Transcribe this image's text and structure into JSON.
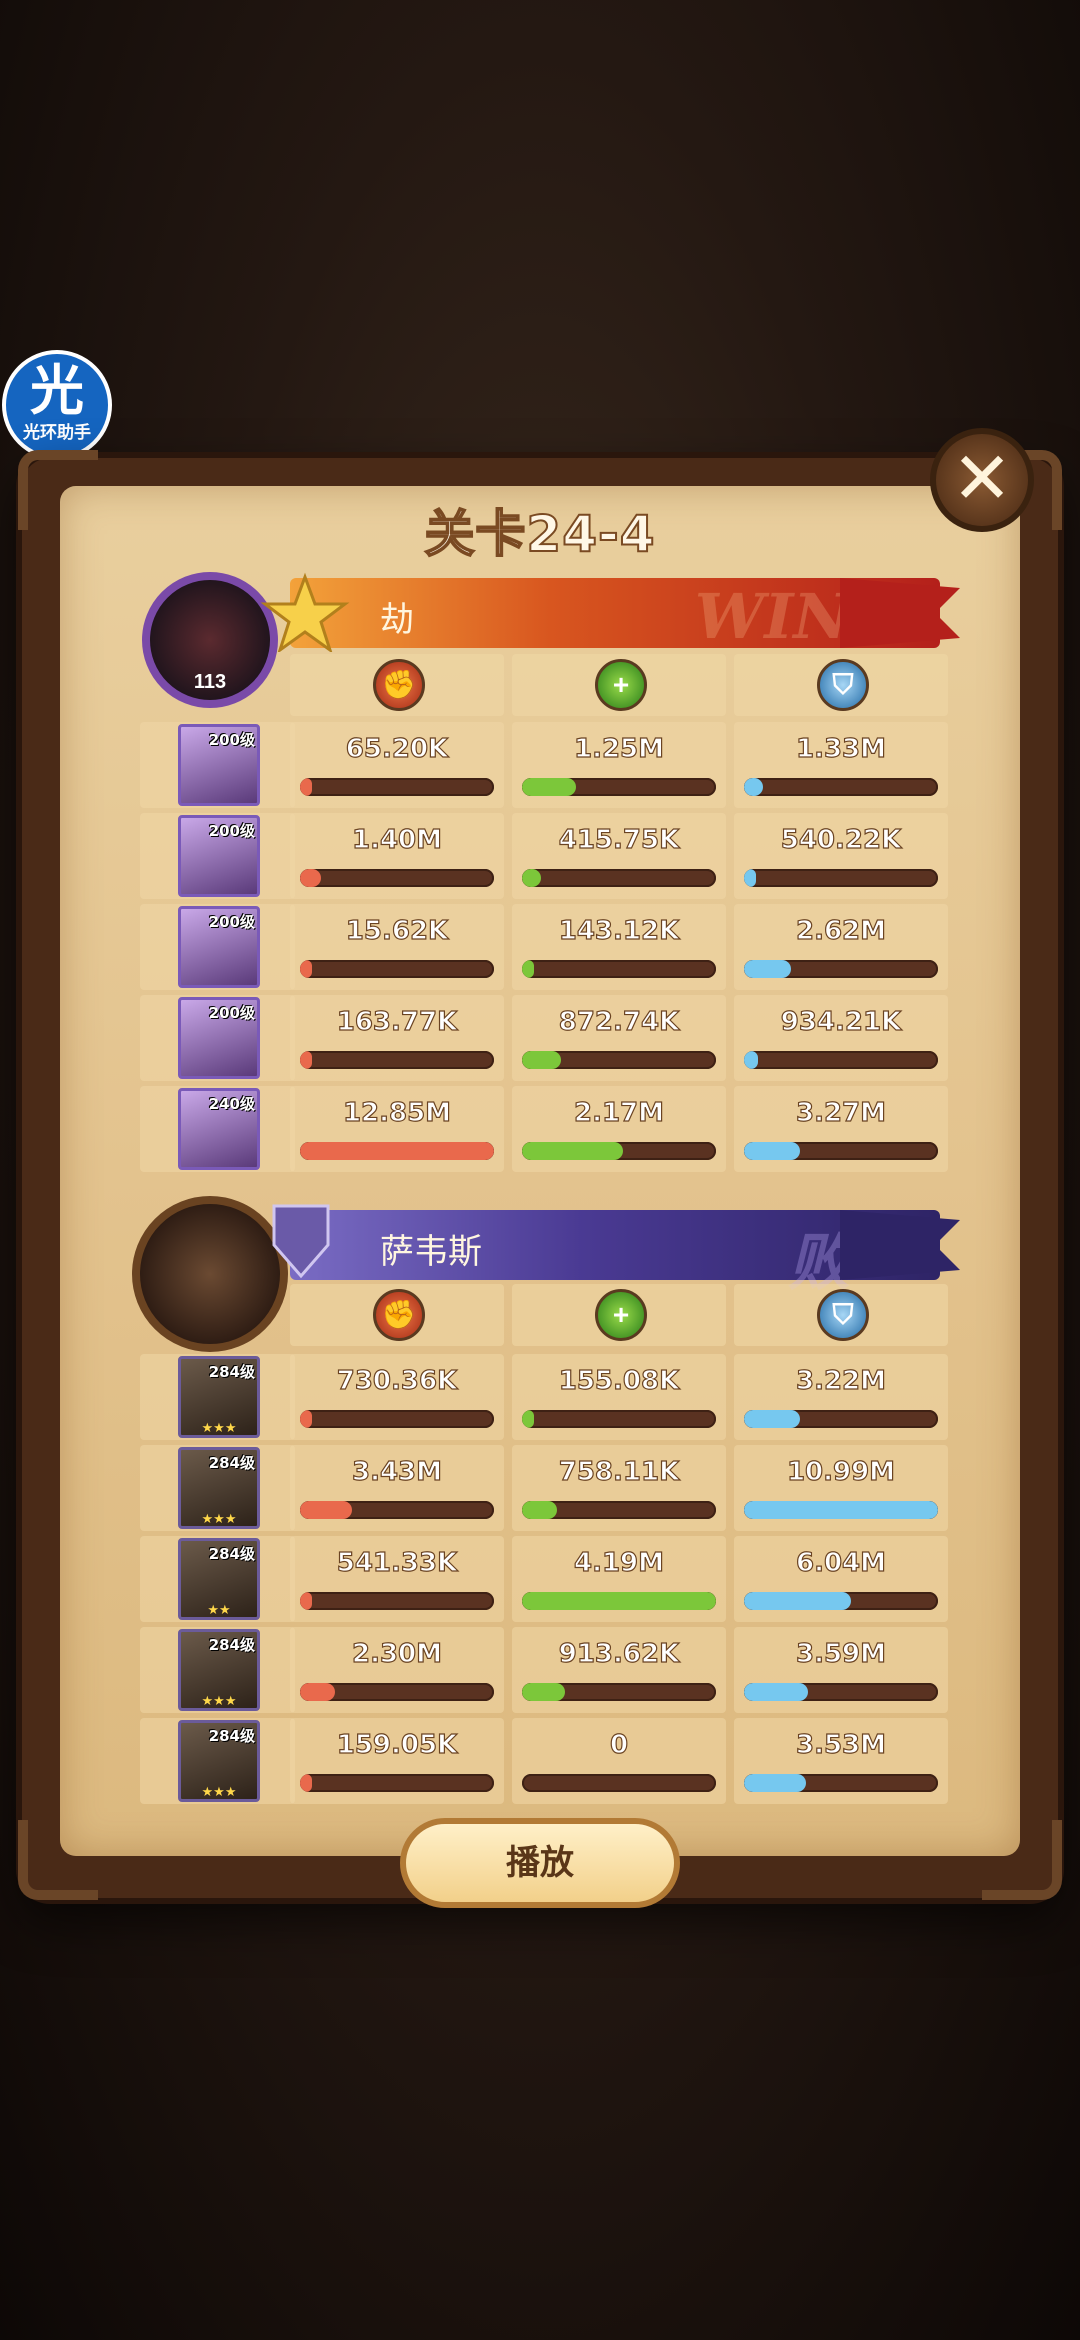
{
  "badge": {
    "char": "光",
    "label": "光环助手"
  },
  "dialog": {
    "title": "关卡24-4",
    "close_glyph": "✕",
    "play_label": "播放"
  },
  "winner": {
    "name": "劫",
    "result_word": "WIN",
    "avatar_level": "113",
    "heroes": [
      {
        "level": "200级",
        "damage": "65.20K",
        "healing": "1.25M",
        "taken": "1.33M",
        "damage_pct": 0.02,
        "healing_pct": 0.28,
        "taken_pct": 0.1
      },
      {
        "level": "200级",
        "damage": "1.40M",
        "healing": "415.75K",
        "taken": "540.22K",
        "damage_pct": 0.11,
        "healing_pct": 0.1,
        "taken_pct": 0.04
      },
      {
        "level": "200级",
        "damage": "15.62K",
        "healing": "143.12K",
        "taken": "2.62M",
        "damage_pct": 0.01,
        "healing_pct": 0.03,
        "taken_pct": 0.24
      },
      {
        "level": "200级",
        "damage": "163.77K",
        "healing": "872.74K",
        "taken": "934.21K",
        "damage_pct": 0.02,
        "healing_pct": 0.2,
        "taken_pct": 0.07
      },
      {
        "level": "240级",
        "damage": "12.85M",
        "healing": "2.17M",
        "taken": "3.27M",
        "damage_pct": 1.0,
        "healing_pct": 0.52,
        "taken_pct": 0.29
      }
    ]
  },
  "loser": {
    "name": "萨韦斯",
    "result_word": "败",
    "heroes": [
      {
        "level": "284级",
        "stars": "★★★",
        "damage": "730.36K",
        "healing": "155.08K",
        "taken": "3.22M",
        "damage_pct": 0.05,
        "healing_pct": 0.04,
        "taken_pct": 0.29
      },
      {
        "level": "284级",
        "stars": "★★★",
        "damage": "3.43M",
        "healing": "758.11K",
        "taken": "10.99M",
        "damage_pct": 0.27,
        "healing_pct": 0.18,
        "taken_pct": 1.0
      },
      {
        "level": "284级",
        "stars": "★★",
        "damage": "541.33K",
        "healing": "4.19M",
        "taken": "6.04M",
        "damage_pct": 0.04,
        "healing_pct": 1.0,
        "taken_pct": 0.55
      },
      {
        "level": "284级",
        "stars": "★★★",
        "damage": "2.30M",
        "healing": "913.62K",
        "taken": "3.59M",
        "damage_pct": 0.18,
        "healing_pct": 0.22,
        "taken_pct": 0.33
      },
      {
        "level": "284级",
        "stars": "★★★",
        "damage": "159.05K",
        "healing": "0",
        "taken": "3.53M",
        "damage_pct": 0.01,
        "healing_pct": 0.0,
        "taken_pct": 0.32
      }
    ]
  },
  "colors": {
    "damage": "#e9694c",
    "healing": "#7cc73a",
    "taken": "#76c8ef",
    "win_banner": "#d8561f",
    "lose_banner": "#4a3a93"
  },
  "icons": {
    "damage": "fist-icon",
    "healing": "heal-icon",
    "taken": "shield-icon",
    "close": "close-icon"
  }
}
